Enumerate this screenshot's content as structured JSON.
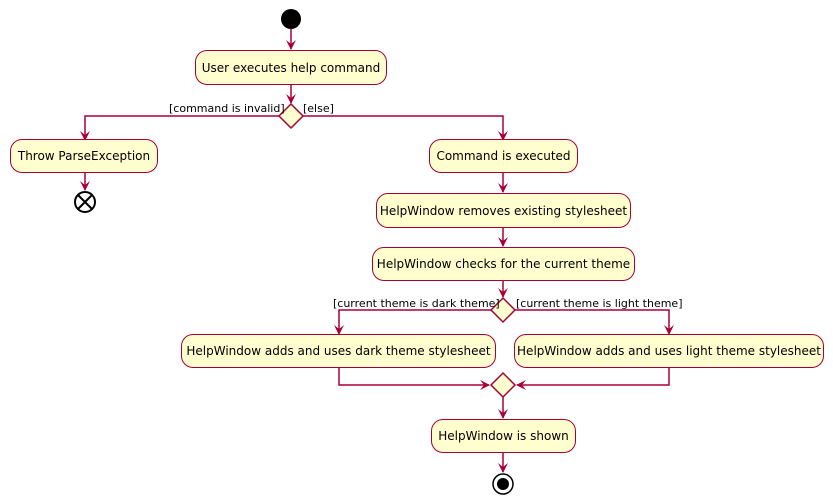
{
  "diagram": {
    "type": "activity",
    "colors": {
      "line": "#A80036",
      "node_fill": "#FEFECE",
      "start": "#000000"
    },
    "nodes": {
      "user_executes": "User executes help command",
      "throw_parse": "Throw ParseException",
      "command_executed": "Command is executed",
      "removes_stylesheet": "HelpWindow removes existing stylesheet",
      "checks_theme": "HelpWindow checks for the current theme",
      "dark_theme": "HelpWindow adds and uses dark theme stylesheet",
      "light_theme": "HelpWindow adds and uses light theme stylesheet",
      "shown": "HelpWindow is shown"
    },
    "guards": {
      "invalid": "[command is invalid]",
      "else": "[else]",
      "dark": "[current theme is dark theme]",
      "light": "[current theme is light theme]"
    }
  }
}
